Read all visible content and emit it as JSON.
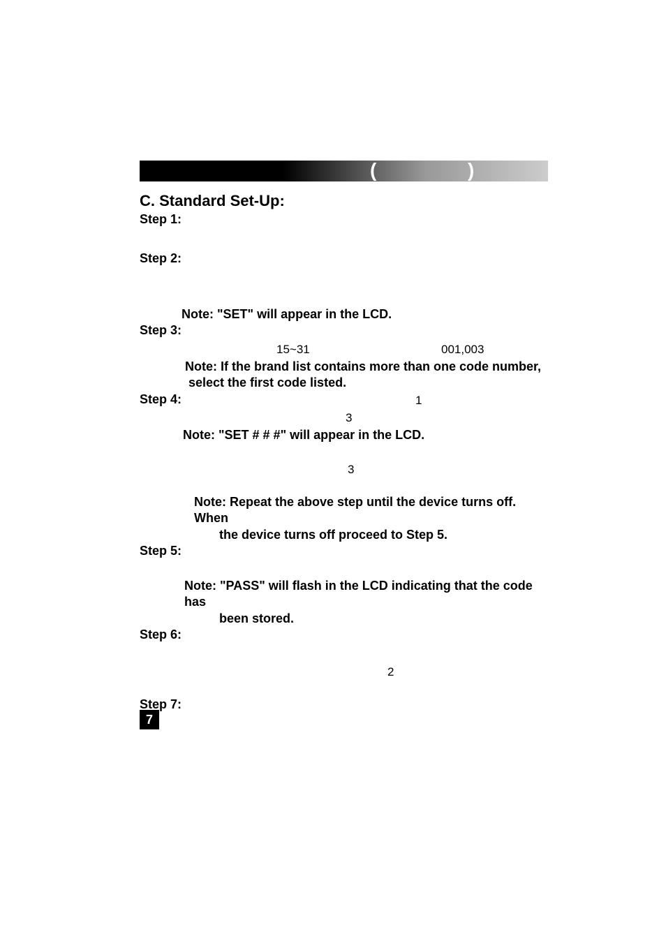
{
  "header": {
    "paren_open": "(",
    "paren_close": ")"
  },
  "section_title": "C. Standard Set-Up:",
  "steps": {
    "s1_label": "Step 1:",
    "s2_label": "Step 2:",
    "s3_label": "Step 3:",
    "s4_label": "Step 4:",
    "s5_label": "Step 5:",
    "s6_label": "Step 6:",
    "s7_label": "Step 7:"
  },
  "notes": {
    "n1": "Note: \"SET\" will appear in the LCD.",
    "n2": "Note: If  the brand  list  contains  more than one code number,",
    "n2b": "select the first code listed.",
    "n3": "Note:  \"SET # # #\"  will appear in the LCD.",
    "n4": "Note: Repeat the above step until the device turns off. When",
    "n4b": "the device turns off proceed to Step 5.",
    "n5": "Note: \"PASS\" will flash in the LCD indicating that the code has",
    "n5b": "been stored."
  },
  "values": {
    "range": "15~31",
    "codes": "001,003",
    "one": "1",
    "three_a": "3",
    "three_b": "3",
    "two": "2"
  },
  "page_number": "7"
}
